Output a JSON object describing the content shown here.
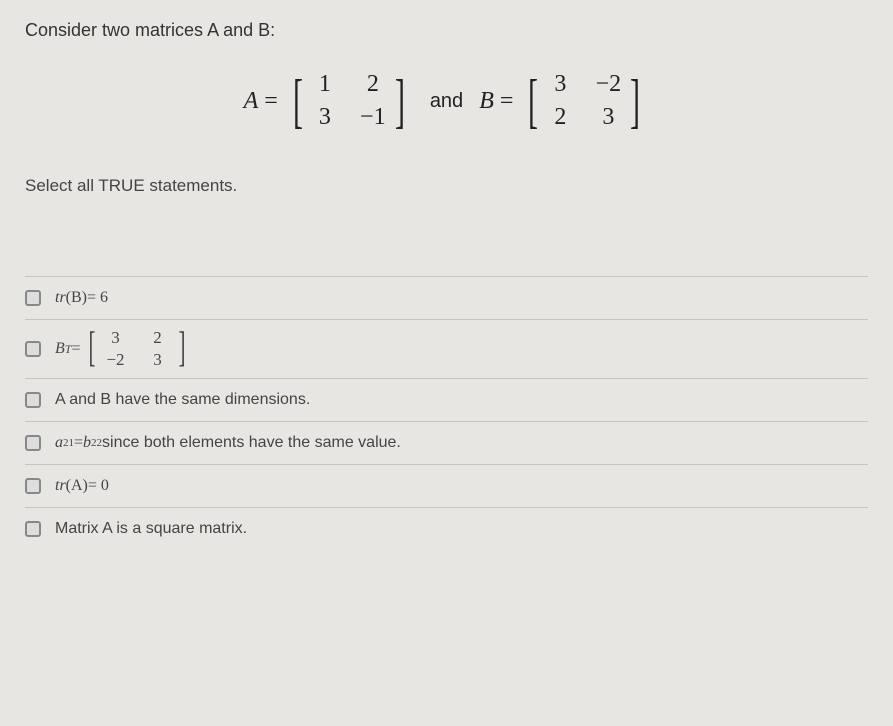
{
  "question": "Consider two matrices A and B:",
  "equation": {
    "a_label": "A",
    "eq_sign": "=",
    "a_matrix": {
      "r1c1": "1",
      "r1c2": "2",
      "r2c1": "3",
      "r2c2": "−1"
    },
    "and_text": "and",
    "b_label": "B",
    "b_matrix": {
      "r1c1": "3",
      "r1c2": "−2",
      "r2c1": "2",
      "r2c2": "3"
    }
  },
  "instruction": "Select all TRUE statements.",
  "options": {
    "opt1": {
      "prefix": "tr",
      "var": "(B)",
      "rest": " = 6"
    },
    "opt2": {
      "var": "B",
      "sup": "T",
      "eq": " = ",
      "matrix": {
        "r1c1": "3",
        "r1c2": "2",
        "r2c1": "−2",
        "r2c2": "3"
      }
    },
    "opt3": "A and B have the same dimensions.",
    "opt4": {
      "a_var": "a",
      "a_sub": "21",
      "eq": " = ",
      "b_var": "b",
      "b_sub": "22",
      "rest": " since both elements have the same value."
    },
    "opt5": {
      "prefix": "tr",
      "var": "(A)",
      "rest": " = 0"
    },
    "opt6": "Matrix A is a square matrix."
  }
}
